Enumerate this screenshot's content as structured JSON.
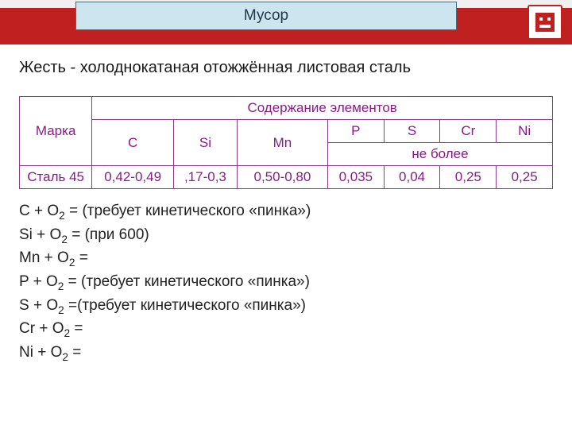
{
  "header": {
    "title": "Мусор",
    "corner_icon": "chip-face-icon"
  },
  "heading": "Жесть - холоднокатаная отожжённая листовая сталь",
  "table": {
    "marka_label": "Марка",
    "content_label": "Содержание элементов",
    "cols": {
      "C": "C",
      "Si": "Si",
      "Mn": "Mn",
      "P": "P",
      "S": "S",
      "Cr": "Cr",
      "Ni": "Ni"
    },
    "no_more": "не более",
    "row": {
      "name": "Сталь 45",
      "C": "0,42-0,49",
      "Si": ",17-0,3",
      "Mn": "0,50-0,80",
      "P": "0,035",
      "S": "0,04",
      "Cr": "0,25",
      "Ni": "0,25"
    }
  },
  "reactions": [
    {
      "el": "C",
      "note": "(требует кинетического «пинка»)"
    },
    {
      "el": "Si",
      "note": "(при 600)"
    },
    {
      "el": "Mn",
      "note": ""
    },
    {
      "el": "P",
      "note": "(требует кинетического «пинка»)"
    },
    {
      "el": "S",
      "note": "(требует кинетического «пинка»)"
    },
    {
      "el": "Cr",
      "note": ""
    },
    {
      "el": "Ni",
      "note": ""
    }
  ]
}
